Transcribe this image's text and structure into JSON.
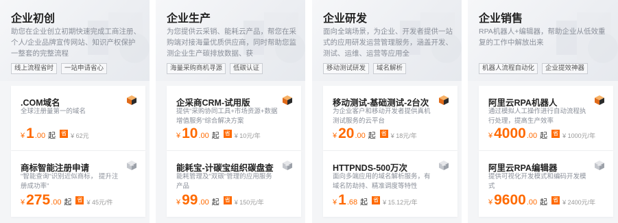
{
  "columns": [
    {
      "title": "企业初创",
      "desc": "助您在企业创立初期快速完成工商注册、个人/企业品牌宣传网站、知识产权保护一整套的完整流程",
      "tags": [
        "线上流程省时",
        "一站申请省心"
      ],
      "cards": [
        {
          "title": ".COM域名",
          "desc": "全球注册量第一的域名",
          "yen": "¥",
          "amount": "1",
          "decimal": ".00",
          "qi": "起",
          "badge": "省",
          "orig": "¥ 62元"
        },
        {
          "title": "商标智能注册申请",
          "desc": "\"智能查询\"识别近似商标， 提升注册成功率\"",
          "yen": "¥",
          "amount": "275",
          "decimal": ".00",
          "qi": "起",
          "badge": "省",
          "orig": "¥ 45元/件"
        }
      ]
    },
    {
      "title": "企业生产",
      "desc": "为您提供云采销、能耗云产品，帮您在采购端对接海量优质供应商，同时帮助您监测企业生产碳排放数据、获",
      "tags": [
        "海量采购商机寻源",
        "低碳认证"
      ],
      "cards": [
        {
          "title": "企采商CRM-试用版",
          "desc": "提供\"采购协同工具+市场资源+数据增值服务\"综合解决方案",
          "yen": "¥",
          "amount": "10",
          "decimal": ".00",
          "qi": "起",
          "badge": "省",
          "orig": "¥ 10元/年"
        },
        {
          "title": "能耗宝-计碳宝组织碳盘查",
          "desc": "能耗管理及\"双碳\"管理的应用服务产品",
          "yen": "¥",
          "amount": "99",
          "decimal": ".00",
          "qi": "起",
          "badge": "省",
          "orig": "¥ 150元/年"
        }
      ]
    },
    {
      "title": "企业研发",
      "desc": "面向全端场景，为企业、开发者提供一站式的应用研发运营管理服务，涵盖开发、测试、运维、运营等应用全",
      "tags": [
        "移动测试研发",
        "域名解析"
      ],
      "cards": [
        {
          "title": "移动测试-基础测试-2台次",
          "desc": "为企业客户和移动开发者提供真机测试服务的云平台",
          "yen": "¥",
          "amount": "20",
          "decimal": ".00",
          "qi": "起",
          "badge": "省",
          "orig": "¥ 18元/年"
        },
        {
          "title": "HTTPNDS-500万次",
          "desc": "面向多端应用的域名解析服务，有域名防劫持、精准调度等特性",
          "yen": "¥",
          "amount": "1",
          "decimal": ".68",
          "qi": "起",
          "badge": "省",
          "orig": "¥ 15.12元/年"
        }
      ]
    },
    {
      "title": "企业销售",
      "desc": "RPA机器人+编辑器，帮助企业从低效重复的工作中解放出来",
      "tags": [
        "机器人流程自动化",
        "企业提效神器"
      ],
      "cards": [
        {
          "title": "阿里云RPA机器人",
          "desc": "通过模拟人工操作进行自动流程执行处理，提高生产效率",
          "yen": "¥",
          "amount": "4000",
          "decimal": ".00",
          "qi": "起",
          "badge": "省",
          "orig": "¥ 1000元/年"
        },
        {
          "title": "阿里云RPA编辑器",
          "desc": "提供可视化开发模式和编码开发模式",
          "yen": "¥",
          "amount": "9600",
          "decimal": ".00",
          "qi": "起",
          "badge": "省",
          "orig": "¥ 2400元/年"
        }
      ]
    }
  ],
  "icons": {
    "card1": "orange-cube-icon",
    "card2": "gray-cube-icon"
  },
  "colors": {
    "accent": "#ff6a00",
    "background": "#f4f5f7"
  }
}
